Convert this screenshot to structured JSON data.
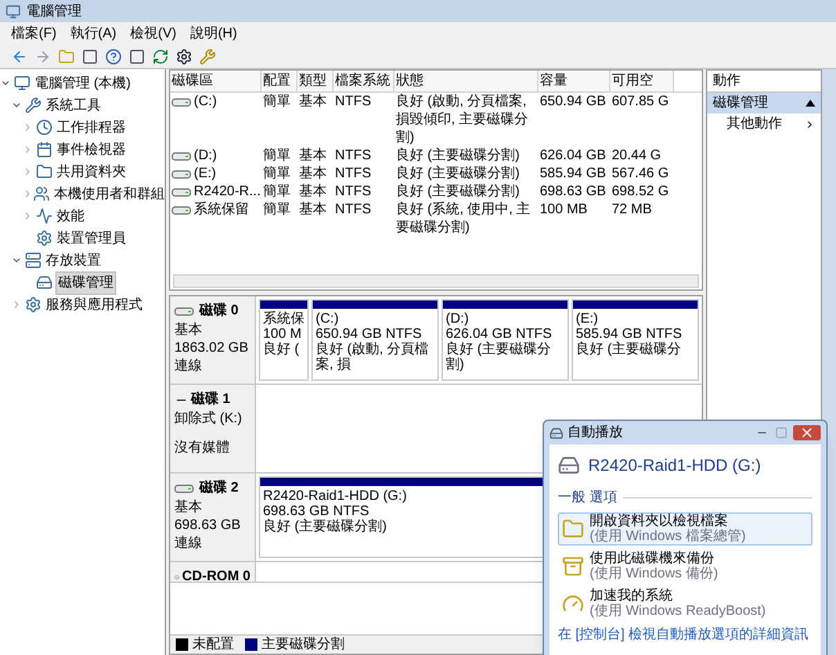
{
  "window": {
    "title": "電腦管理"
  },
  "menu": [
    "檔案(F)",
    "執行(A)",
    "檢視(V)",
    "說明(H)"
  ],
  "tree": [
    {
      "label": "電腦管理 (本機)",
      "selected": false,
      "expanded": true,
      "children": [
        {
          "label": "系統工具",
          "selected": false,
          "expanded": true,
          "children": [
            {
              "label": "工作排程器",
              "selected": false,
              "expanded": false
            },
            {
              "label": "事件檢視器",
              "selected": false,
              "expanded": false
            },
            {
              "label": "共用資料夾",
              "selected": false,
              "expanded": false
            },
            {
              "label": "本機使用者和群組",
              "selected": false,
              "expanded": false
            },
            {
              "label": "效能",
              "selected": false,
              "expanded": false
            },
            {
              "label": "裝置管理員",
              "selected": false
            }
          ]
        },
        {
          "label": "存放裝置",
          "selected": false,
          "expanded": true,
          "children": [
            {
              "label": "磁碟管理",
              "selected": true
            }
          ]
        },
        {
          "label": "服務與應用程式",
          "selected": false,
          "expanded": false
        }
      ]
    }
  ],
  "volumes": {
    "columns": [
      "磁碟區",
      "配置",
      "類型",
      "檔案系統",
      "狀態",
      "容量",
      "可用空"
    ],
    "rows": [
      {
        "cells": [
          "(C:)",
          "簡單",
          "基本",
          "NTFS",
          "良好 (啟動, 分頁檔案, 損毀傾印, 主要磁碟分割)",
          "650.94 GB",
          "607.85 G"
        ]
      },
      {
        "cells": [
          "(D:)",
          "簡單",
          "基本",
          "NTFS",
          "良好 (主要磁碟分割)",
          "626.04 GB",
          "20.44 G"
        ]
      },
      {
        "cells": [
          "(E:)",
          "簡單",
          "基本",
          "NTFS",
          "良好 (主要磁碟分割)",
          "585.94 GB",
          "567.46 G"
        ]
      },
      {
        "cells": [
          "R2420-R...",
          "簡單",
          "基本",
          "NTFS",
          "良好 (主要磁碟分割)",
          "698.63 GB",
          "698.52 G"
        ]
      },
      {
        "cells": [
          "系統保留",
          "簡單",
          "基本",
          "NTFS",
          "良好 (系統, 使用中, 主要磁碟分割)",
          "100 MB",
          "72 MB"
        ]
      }
    ]
  },
  "disks": [
    {
      "name": "磁碟 0",
      "kind": "hdd",
      "lines": [
        "基本",
        "1863.02 GB",
        "連線"
      ],
      "partitions": [
        {
          "lines": [
            "系統保",
            "100 M",
            "良好 ("
          ]
        },
        {
          "lines": [
            "(C:)",
            "650.94 GB NTFS",
            "良好 (啟動, 分頁檔案, 損"
          ]
        },
        {
          "lines": [
            "(D:)",
            "626.04 GB NTFS",
            "良好 (主要磁碟分割)"
          ]
        },
        {
          "lines": [
            "(E:)",
            "585.94 GB NTFS",
            "良好 (主要磁碟分"
          ]
        }
      ]
    },
    {
      "name": "磁碟 1",
      "kind": "removable",
      "lines": [
        "卸除式 (K:)",
        "沒有媒體"
      ]
    },
    {
      "name": "磁碟 2",
      "kind": "hdd",
      "lines": [
        "基本",
        "698.63 GB",
        "連線"
      ],
      "partitions": [
        {
          "lines": [
            "R2420-Raid1-HDD  (G:)",
            "698.63 GB NTFS",
            "良好 (主要磁碟分割)"
          ]
        }
      ]
    },
    {
      "name": "CD-ROM 0",
      "kind": "cdrom"
    }
  ],
  "legend": [
    {
      "label": "未配置",
      "color": "#000000"
    },
    {
      "label": "主要磁碟分割",
      "color": "#000080"
    }
  ],
  "actions": {
    "title": "動作",
    "items": [
      {
        "label": "磁碟管理",
        "kind": "header"
      },
      {
        "label": "其他動作",
        "kind": "submenu"
      }
    ]
  },
  "autoplay": {
    "title": "自動播放",
    "drive": "R2420-Raid1-HDD (G:)",
    "section": "一般 選項",
    "options": [
      {
        "kind": "folder",
        "title": "開啟資料夾以檢視檔案",
        "subtitle": "(使用 Windows 檔案總管)",
        "selected": true
      },
      {
        "kind": "backup",
        "title": "使用此磁碟機來備份",
        "subtitle": "(使用 Windows 備份)",
        "selected": false
      },
      {
        "kind": "speed",
        "title": "加速我的系統",
        "subtitle": "(使用 Windows ReadyBoost)",
        "selected": false
      }
    ],
    "link": "在 [控制台] 檢視自動播放選項的詳細資訊"
  }
}
